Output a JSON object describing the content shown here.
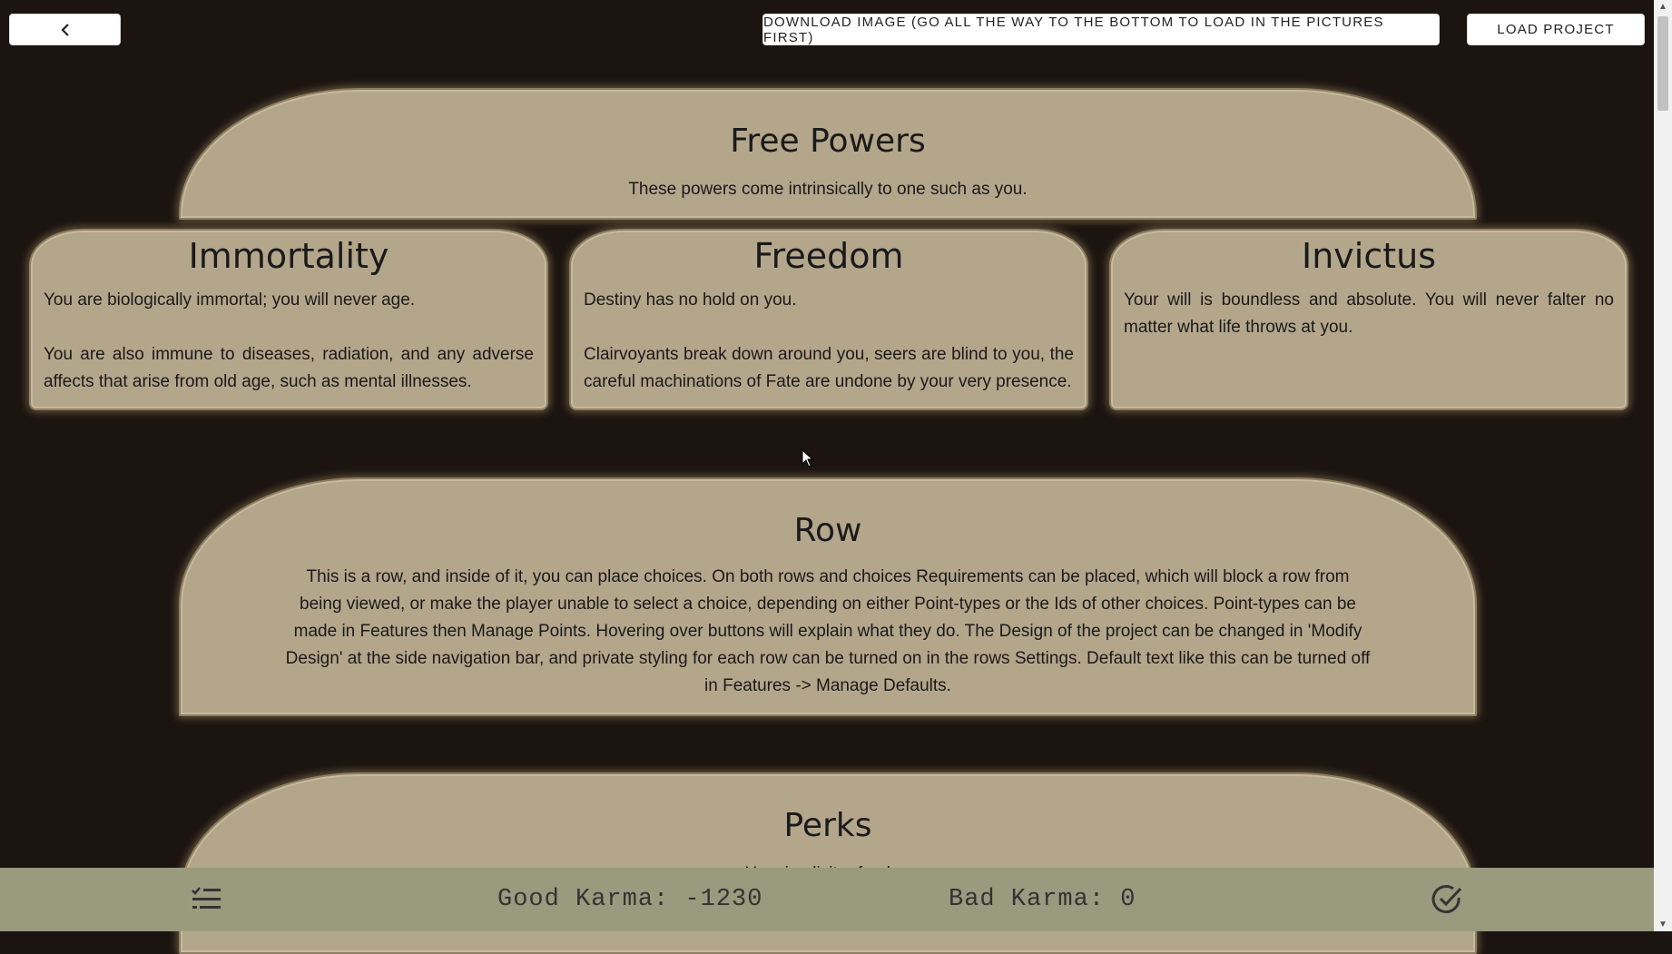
{
  "toolbar": {
    "back_icon": "chevron-left-icon",
    "download_label": "DOWNLOAD IMAGE (GO ALL THE WAY TO THE BOTTOM TO LOAD IN THE PICTURES FIRST)",
    "load_label": "LOAD PROJECT"
  },
  "rows": {
    "free": {
      "title": "Free Powers",
      "description": "These powers come intrinsically to one such as you."
    },
    "row": {
      "title": "Row",
      "description": "This is a row, and inside of it, you can place choices. On both rows and choices Requirements can be placed, which will block a row from being viewed, or make the player unable to select a choice, depending on either Point-types or the Ids of other choices. Point-types can be made in Features then Manage Points. Hovering over buttons will explain what they do. The Design of the project can be changed in 'Modify Design' at the side navigation bar, and private styling for each row can be turned on in the rows Settings. Default text like this can be turned off in Features -> Manage Defaults."
    },
    "perks": {
      "title": "Perks",
      "description": "Your implicit refresh..."
    }
  },
  "choices": [
    {
      "title": "Immortality",
      "text": "You are biologically immortal; you will never age.\n\nYou are also immune to diseases, radiation, and any adverse affects that arise from old age, such as mental illnesses."
    },
    {
      "title": "Freedom",
      "text": "Destiny has no hold on you.\n\nClairvoyants break down around you, seers are blind to you, the careful machinations of Fate are undone by your very presence."
    },
    {
      "title": "Invictus",
      "text": "Your will is boundless and absolute. You will never falter no matter what life throws at you."
    }
  ],
  "bottom_bar": {
    "good_karma": "Good Karma: -1230",
    "bad_karma": "Bad Karma: 0",
    "left_icon": "checklist-icon",
    "right_icon": "check-circle-icon"
  },
  "colors": {
    "background": "#1b1410",
    "card": "#b4a68b",
    "bottom_bar": "#999a7e"
  }
}
